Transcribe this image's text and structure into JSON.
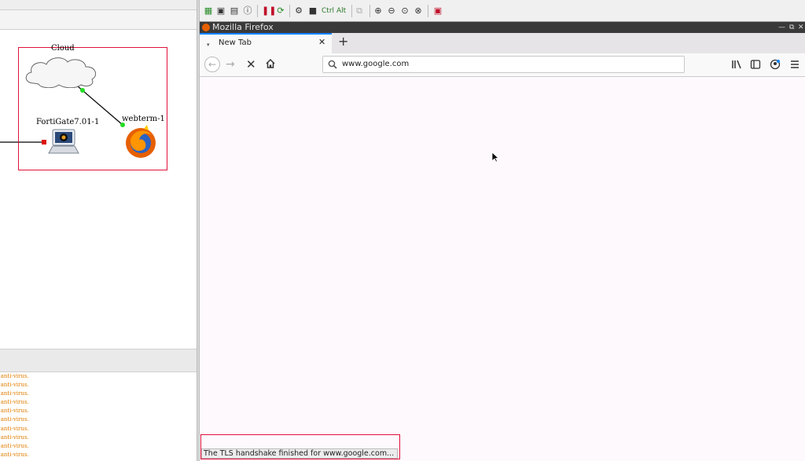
{
  "topology": {
    "cloud_label": "Cloud",
    "fortigate_label": "FortiGate7.01-1",
    "webterm_label": "webterm-1"
  },
  "log": {
    "lines": [
      "n anti-virus.",
      "n anti-virus.",
      "n anti-virus.",
      "n anti-virus.",
      "n anti-virus.",
      "n anti-virus.",
      "n anti-virus.",
      "n anti-virus.",
      "n anti-virus.",
      "n anti-virus."
    ]
  },
  "vnc_toolbar": {
    "ctrl_label": "Ctrl",
    "alt_label": "Alt"
  },
  "firefox": {
    "window_title": "Mozilla Firefox",
    "tab_label": "New Tab",
    "url": "www.google.com",
    "status_text": "The TLS handshake finished for www.google.com..."
  },
  "colors": {
    "highlight": "#e0103a",
    "link_endpoint_green": "#22dd22",
    "link_endpoint_red": "#dd1111",
    "log_text": "#e07d00",
    "firefox_tab_accent": "#0a84ff"
  }
}
